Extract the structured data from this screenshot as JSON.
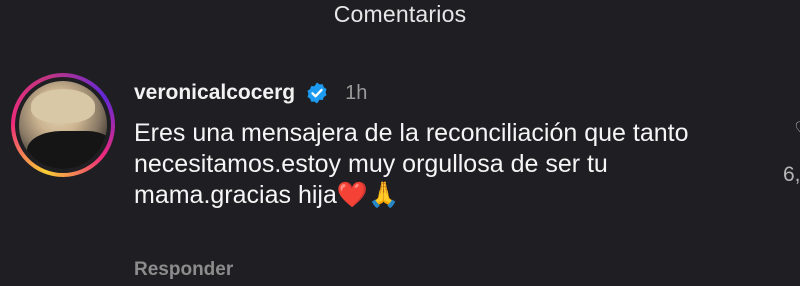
{
  "header": {
    "title": "Comentarios"
  },
  "comment": {
    "username": "veronicalcocerg",
    "verified_icon": "verified-badge-icon",
    "time": "1h",
    "text_main": "Eres una mensajera de la reconciliación que tanto necesitamos.estoy muy orgullosa de ser tu mama.gracias hija",
    "emoji_heart": "❤️",
    "emoji_pray": "🙏",
    "reply_label": "Responder"
  },
  "side": {
    "like_icon": "heart-outline-icon",
    "like_count": "6,"
  },
  "colors": {
    "background": "#1f1f23",
    "verified": "#1d9bf0",
    "story_ring": [
      "#f9ce34",
      "#ee2a7b",
      "#6228d7"
    ]
  }
}
